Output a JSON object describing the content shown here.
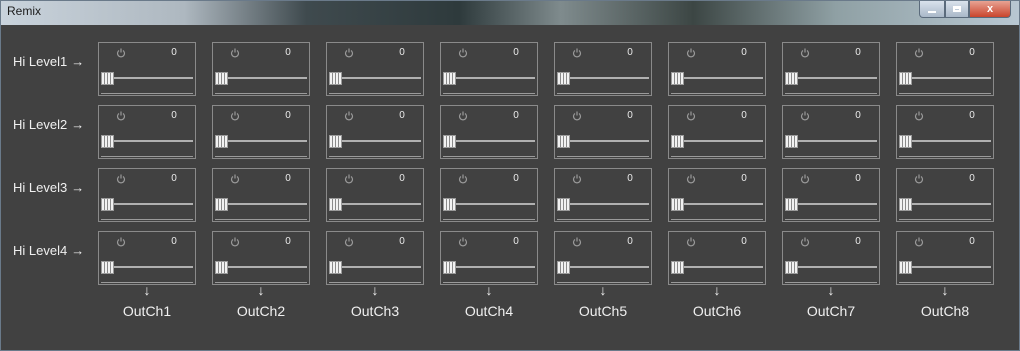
{
  "window": {
    "title": "Remix",
    "minimize_label": "",
    "maximize_label": "",
    "close_label": "x"
  },
  "rows": [
    {
      "label": "Hi Level1",
      "arrow": "→"
    },
    {
      "label": "Hi Level2",
      "arrow": "→"
    },
    {
      "label": "Hi Level3",
      "arrow": "→"
    },
    {
      "label": "Hi Level4",
      "arrow": "→"
    }
  ],
  "outputs": [
    {
      "label": "OutCh1",
      "arrow": "↓"
    },
    {
      "label": "OutCh2",
      "arrow": "↓"
    },
    {
      "label": "OutCh3",
      "arrow": "↓"
    },
    {
      "label": "OutCh4",
      "arrow": "↓"
    },
    {
      "label": "OutCh5",
      "arrow": "↓"
    },
    {
      "label": "OutCh6",
      "arrow": "↓"
    },
    {
      "label": "OutCh7",
      "arrow": "↓"
    },
    {
      "label": "OutCh8",
      "arrow": "↓"
    }
  ],
  "cells": [
    [
      "0",
      "0",
      "0",
      "0",
      "0",
      "0",
      "0",
      "0"
    ],
    [
      "0",
      "0",
      "0",
      "0",
      "0",
      "0",
      "0",
      "0"
    ],
    [
      "0",
      "0",
      "0",
      "0",
      "0",
      "0",
      "0",
      "0"
    ],
    [
      "0",
      "0",
      "0",
      "0",
      "0",
      "0",
      "0",
      "0"
    ]
  ],
  "icons": {
    "cell_power": "power-icon",
    "row_arrow": "right-arrow-icon",
    "output_arrow": "down-arrow-icon"
  }
}
